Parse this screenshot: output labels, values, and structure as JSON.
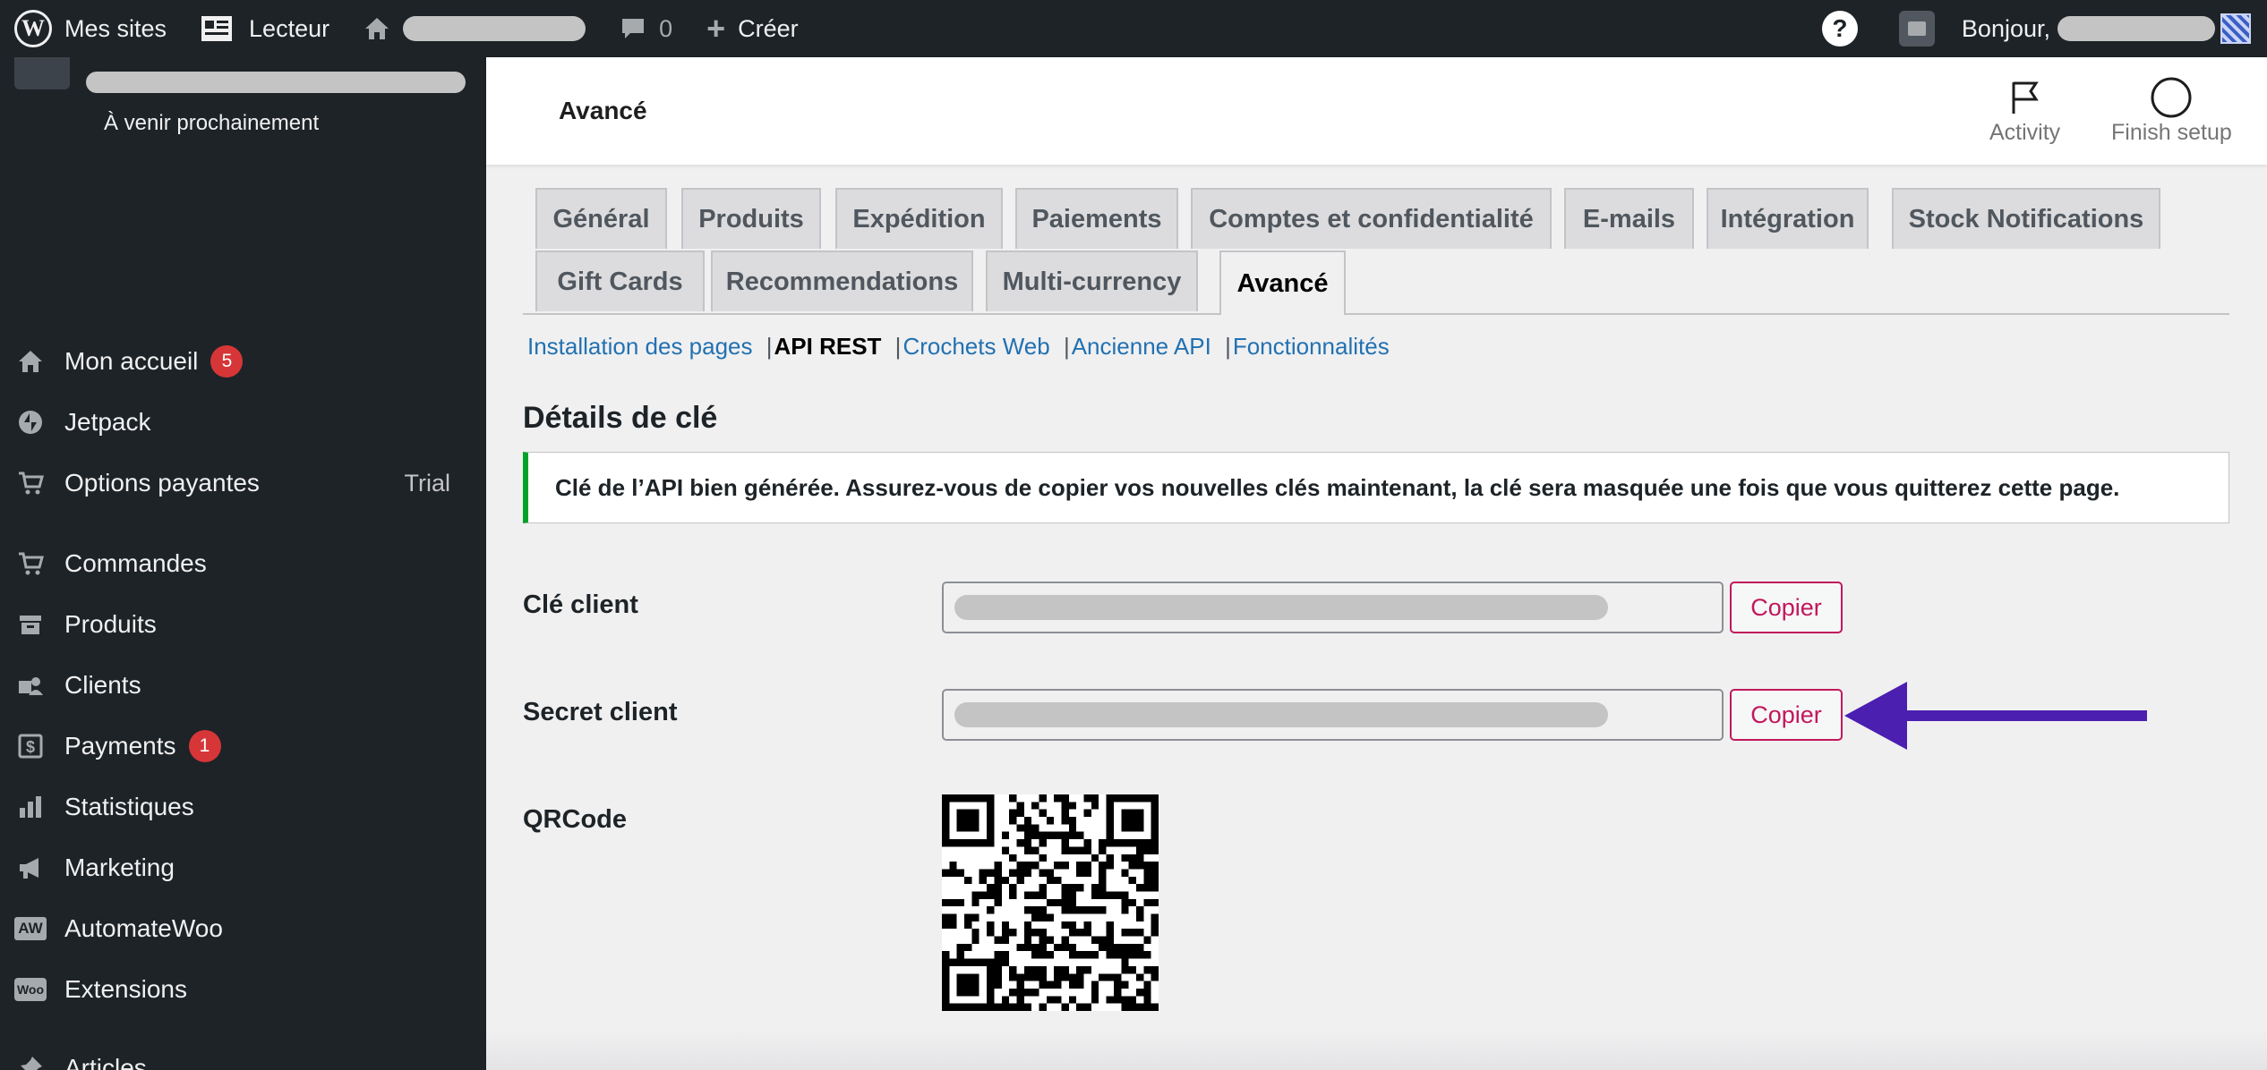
{
  "admin_bar": {
    "my_sites": "Mes sites",
    "reader": "Lecteur",
    "comments_count": "0",
    "create": "Créer",
    "greeting": "Bonjour,"
  },
  "sidebar": {
    "site_status": "À venir prochainement",
    "items": [
      {
        "label": "Mon accueil",
        "icon": "home-icon",
        "badge": "5"
      },
      {
        "label": "Jetpack",
        "icon": "jetpack-icon"
      },
      {
        "label": "Options payantes",
        "icon": "cart-icon",
        "extra": "Trial"
      },
      {
        "label": "Commandes",
        "icon": "cart-icon"
      },
      {
        "label": "Produits",
        "icon": "archive-icon"
      },
      {
        "label": "Clients",
        "icon": "users-icon"
      },
      {
        "label": "Payments",
        "icon": "dollar-icon",
        "badge": "1"
      },
      {
        "label": "Statistiques",
        "icon": "bar-chart-icon"
      },
      {
        "label": "Marketing",
        "icon": "megaphone-icon"
      },
      {
        "label": "AutomateWoo",
        "icon": "automatewoo-icon",
        "icon_text": "AW"
      },
      {
        "label": "Extensions",
        "icon": "woo-icon",
        "icon_text": "Woo"
      },
      {
        "label": "Articles",
        "icon": "pin-icon"
      }
    ]
  },
  "header": {
    "title": "Avancé",
    "activity": "Activity",
    "finish_setup": "Finish setup"
  },
  "tabs": [
    {
      "label": "Général"
    },
    {
      "label": "Produits"
    },
    {
      "label": "Expédition"
    },
    {
      "label": "Paiements"
    },
    {
      "label": "Comptes et confidentialité"
    },
    {
      "label": "E-mails"
    },
    {
      "label": "Intégration"
    },
    {
      "label": "Stock Notifications"
    },
    {
      "label": "Gift Cards"
    },
    {
      "label": "Recommendations"
    },
    {
      "label": "Multi-currency"
    },
    {
      "label": "Avancé",
      "active": true
    }
  ],
  "subsections": {
    "pages": "Installation des pages",
    "rest_api": "API REST",
    "webhooks": "Crochets Web",
    "legacy_api": "Ancienne API",
    "features": "Fonctionnalités",
    "separator": "|"
  },
  "key_details": {
    "title": "Détails de clé",
    "notice": "Clé de l’API bien générée. Assurez-vous de copier vos nouvelles clés maintenant, la clé sera masquée une fois que vous quitterez cette page.",
    "consumer_key_label": "Clé client",
    "consumer_secret_label": "Secret client",
    "qrcode_label": "QRCode",
    "copy_label": "Copier"
  },
  "colors": {
    "admin_bar": "#1d2327",
    "link": "#2271b1",
    "copy_button": "#c2185b",
    "notice_success": "#00a32a",
    "arrow": "#4b1fb0",
    "badge": "#d63638"
  }
}
